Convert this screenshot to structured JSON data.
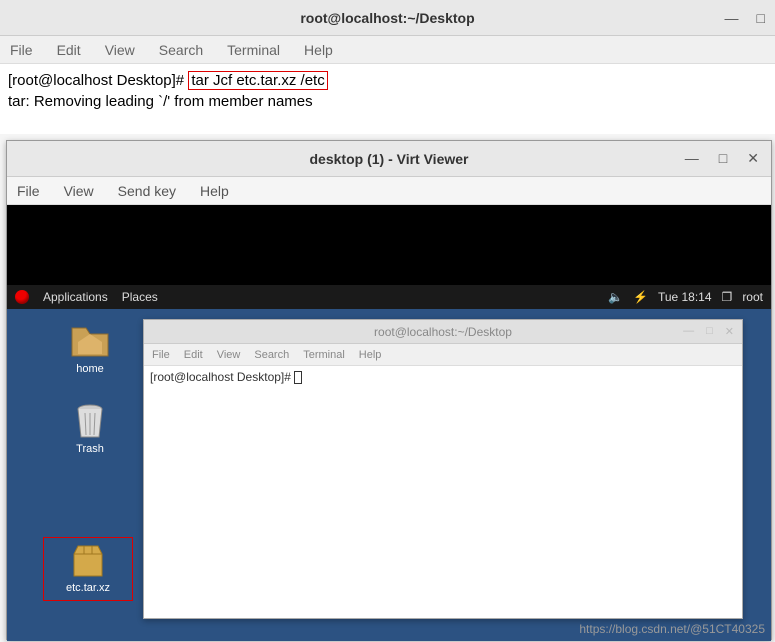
{
  "outer_terminal": {
    "title": "root@localhost:~/Desktop",
    "menu": [
      "File",
      "Edit",
      "View",
      "Search",
      "Terminal",
      "Help"
    ],
    "prompt": "[root@localhost Desktop]# ",
    "command": "tar Jcf etc.tar.xz /etc",
    "output_line": "tar: Removing leading `/' from member names"
  },
  "virt_viewer": {
    "title": "desktop (1) - Virt Viewer",
    "menu": [
      "File",
      "View",
      "Send key",
      "Help"
    ]
  },
  "gnome": {
    "apps": "Applications",
    "places": "Places",
    "clock": "Tue 18:14",
    "user": "root",
    "icons": {
      "home": "home",
      "trash": "Trash",
      "tar": "etc.tar.xz"
    }
  },
  "inner_terminal": {
    "title": "root@localhost:~/Desktop",
    "menu": [
      "File",
      "Edit",
      "View",
      "Search",
      "Terminal",
      "Help"
    ],
    "prompt": "[root@localhost Desktop]# "
  },
  "watermark": "https://blog.csdn.net/@51CT40325"
}
